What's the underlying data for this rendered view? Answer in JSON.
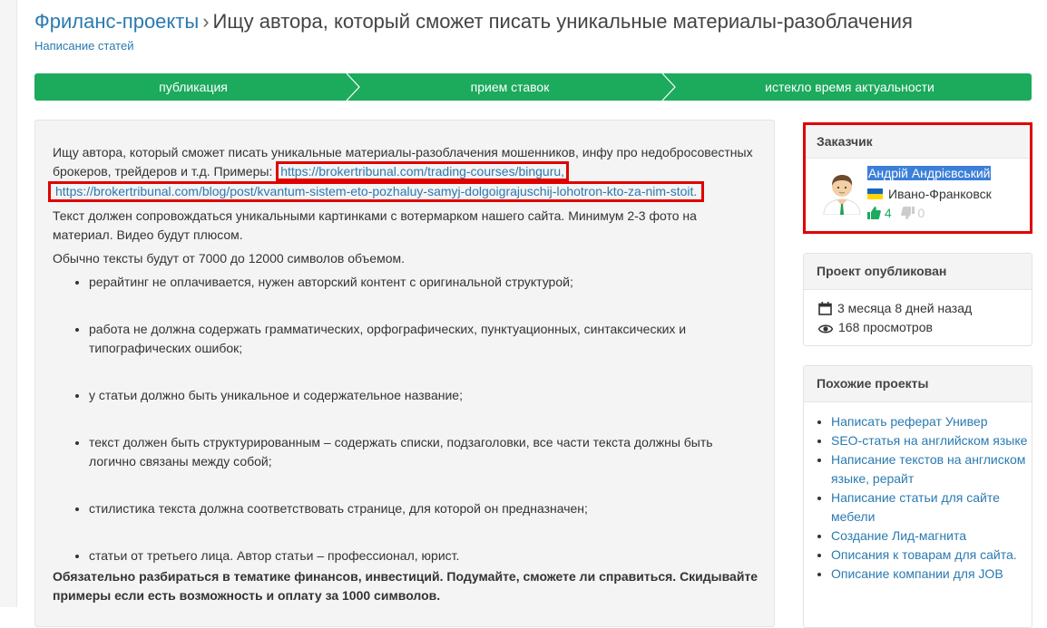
{
  "breadcrumb": {
    "root": "Фриланс-проекты",
    "separator": "›",
    "title": "Ищу автора, который сможет писать уникальные материалы-разоблачения"
  },
  "category": "Написание статей",
  "progress": {
    "stages": [
      "публикация",
      "прием ставок",
      "истекло время актуальности"
    ],
    "color": "#1caa5c"
  },
  "description": {
    "intro": "Ищу автора, который сможет писать уникальные материалы-разоблачения мошенников, инфу про недобросовестных брокеров,  трейдеров и т.д. Примеры: ",
    "link1": "https://brokertribunal.com/trading-courses/binguru,",
    "link2": "https://brokertribunal.com/blog/post/kvantum-sistem-eto-pozhaluy-samyj-dolgoigrajuschij-lohotron-kto-za-nim-stoit.",
    "p2": "Текст должен сопровождаться уникальными картинками с вотермарком нашего сайта. Минимум 2-3 фото на материал. Видео будут плюсом.",
    "p3": "Обычно тексты будут от 7000 до 12000 символов объемом.",
    "requirements": [
      "рерайтинг не оплачивается, нужен авторский контент с оригинальной структурой;",
      "работа не должна содержать грамматических, орфографических, пунктуационных, синтаксических и типографических ошибок;",
      "у статьи должно быть уникальное и содержательное название;",
      "текст должен быть структурированным – содержать списки, подзаголовки, все части текста должны быть логично связаны между собой;",
      "стилистика текста должна соответствовать странице, для которой он предназначен;",
      "статьи от третьего лица. Автор статьи – профессионал, юрист."
    ],
    "bold_note": "Обязательно разбираться в тематике финансов, инвестиций. Подумайте, сможете ли справиться. Скидывайте примеры если есть возможность и оплату за 1000 символов."
  },
  "client": {
    "header": "Заказчик",
    "name": "Андрій Андрієвський",
    "city": "Ивано-Франковск",
    "rating_up": "4",
    "rating_down": "0",
    "flag_colors": [
      "#1565c0",
      "#ffd600"
    ]
  },
  "published": {
    "header": "Проект опубликован",
    "date": "3 месяца 8 дней назад",
    "views": "168 просмотров"
  },
  "similar": {
    "header": "Похожие проекты",
    "items": [
      "Написать реферат Универ",
      "SEO-статья на английском языке",
      "Написание текстов на англиском языке, рерайт",
      "Написание статьи для сайте мебели",
      "Создание Лид-магнита",
      "Описания к товарам для сайта.",
      "Описание компании для JOB"
    ]
  },
  "colors": {
    "link": "#2a7ab0",
    "highlight": "#e00000",
    "selection": "#3b7fd8"
  }
}
